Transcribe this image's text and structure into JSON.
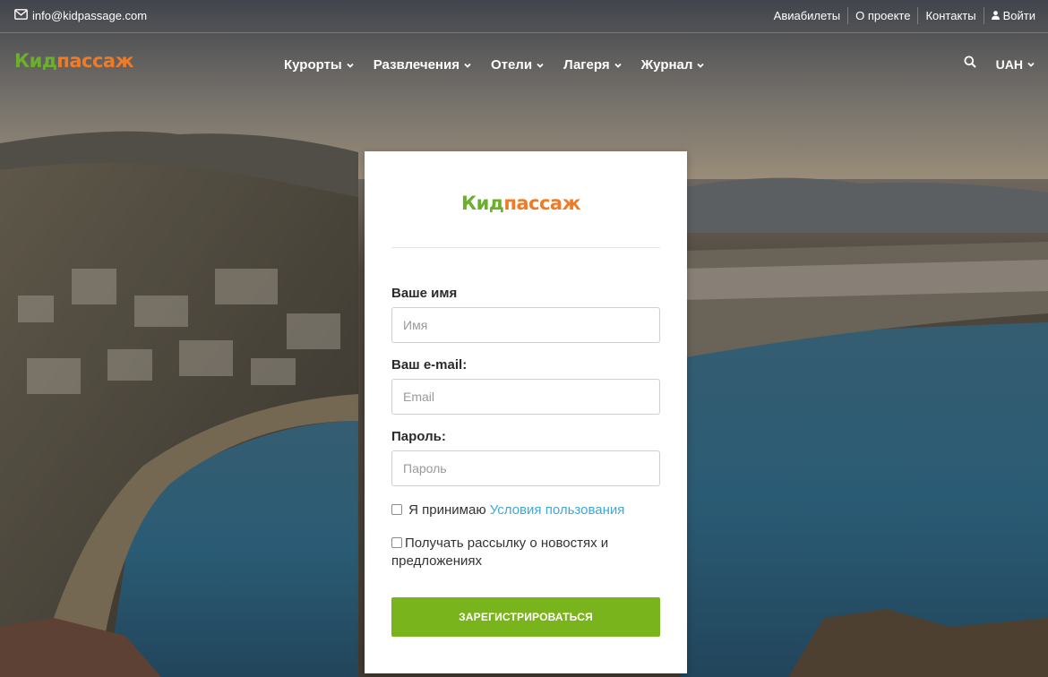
{
  "topbar": {
    "email": "info@kidpassage.com",
    "links": {
      "flights": "Авиабилеты",
      "about": "О проекте",
      "contacts": "Контакты",
      "login": "Войти"
    }
  },
  "brand": {
    "logo_part1": "Кид",
    "logo_part2": "пассаж",
    "colors": {
      "green": "#6bb02a",
      "orange": "#f07b27"
    }
  },
  "nav": {
    "items": [
      "Курорты",
      "Развлечения",
      "Отели",
      "Лагеря",
      "Журнал"
    ],
    "currency": "UAH"
  },
  "form": {
    "name_label": "Ваше имя",
    "name_placeholder": "Имя",
    "email_label": "Ваш e-mail:",
    "email_placeholder": "Email",
    "password_label": "Пароль:",
    "password_placeholder": "Пароль",
    "terms_prefix": "Я принимаю",
    "terms_link": "Условия пользования",
    "newsletter": "Получать рассылку о новостях и предложениях",
    "submit": "ЗАРЕГИСТРИРОВАТЬСЯ",
    "accent_color": "#7ab41d",
    "link_color": "#3ea9d5"
  }
}
